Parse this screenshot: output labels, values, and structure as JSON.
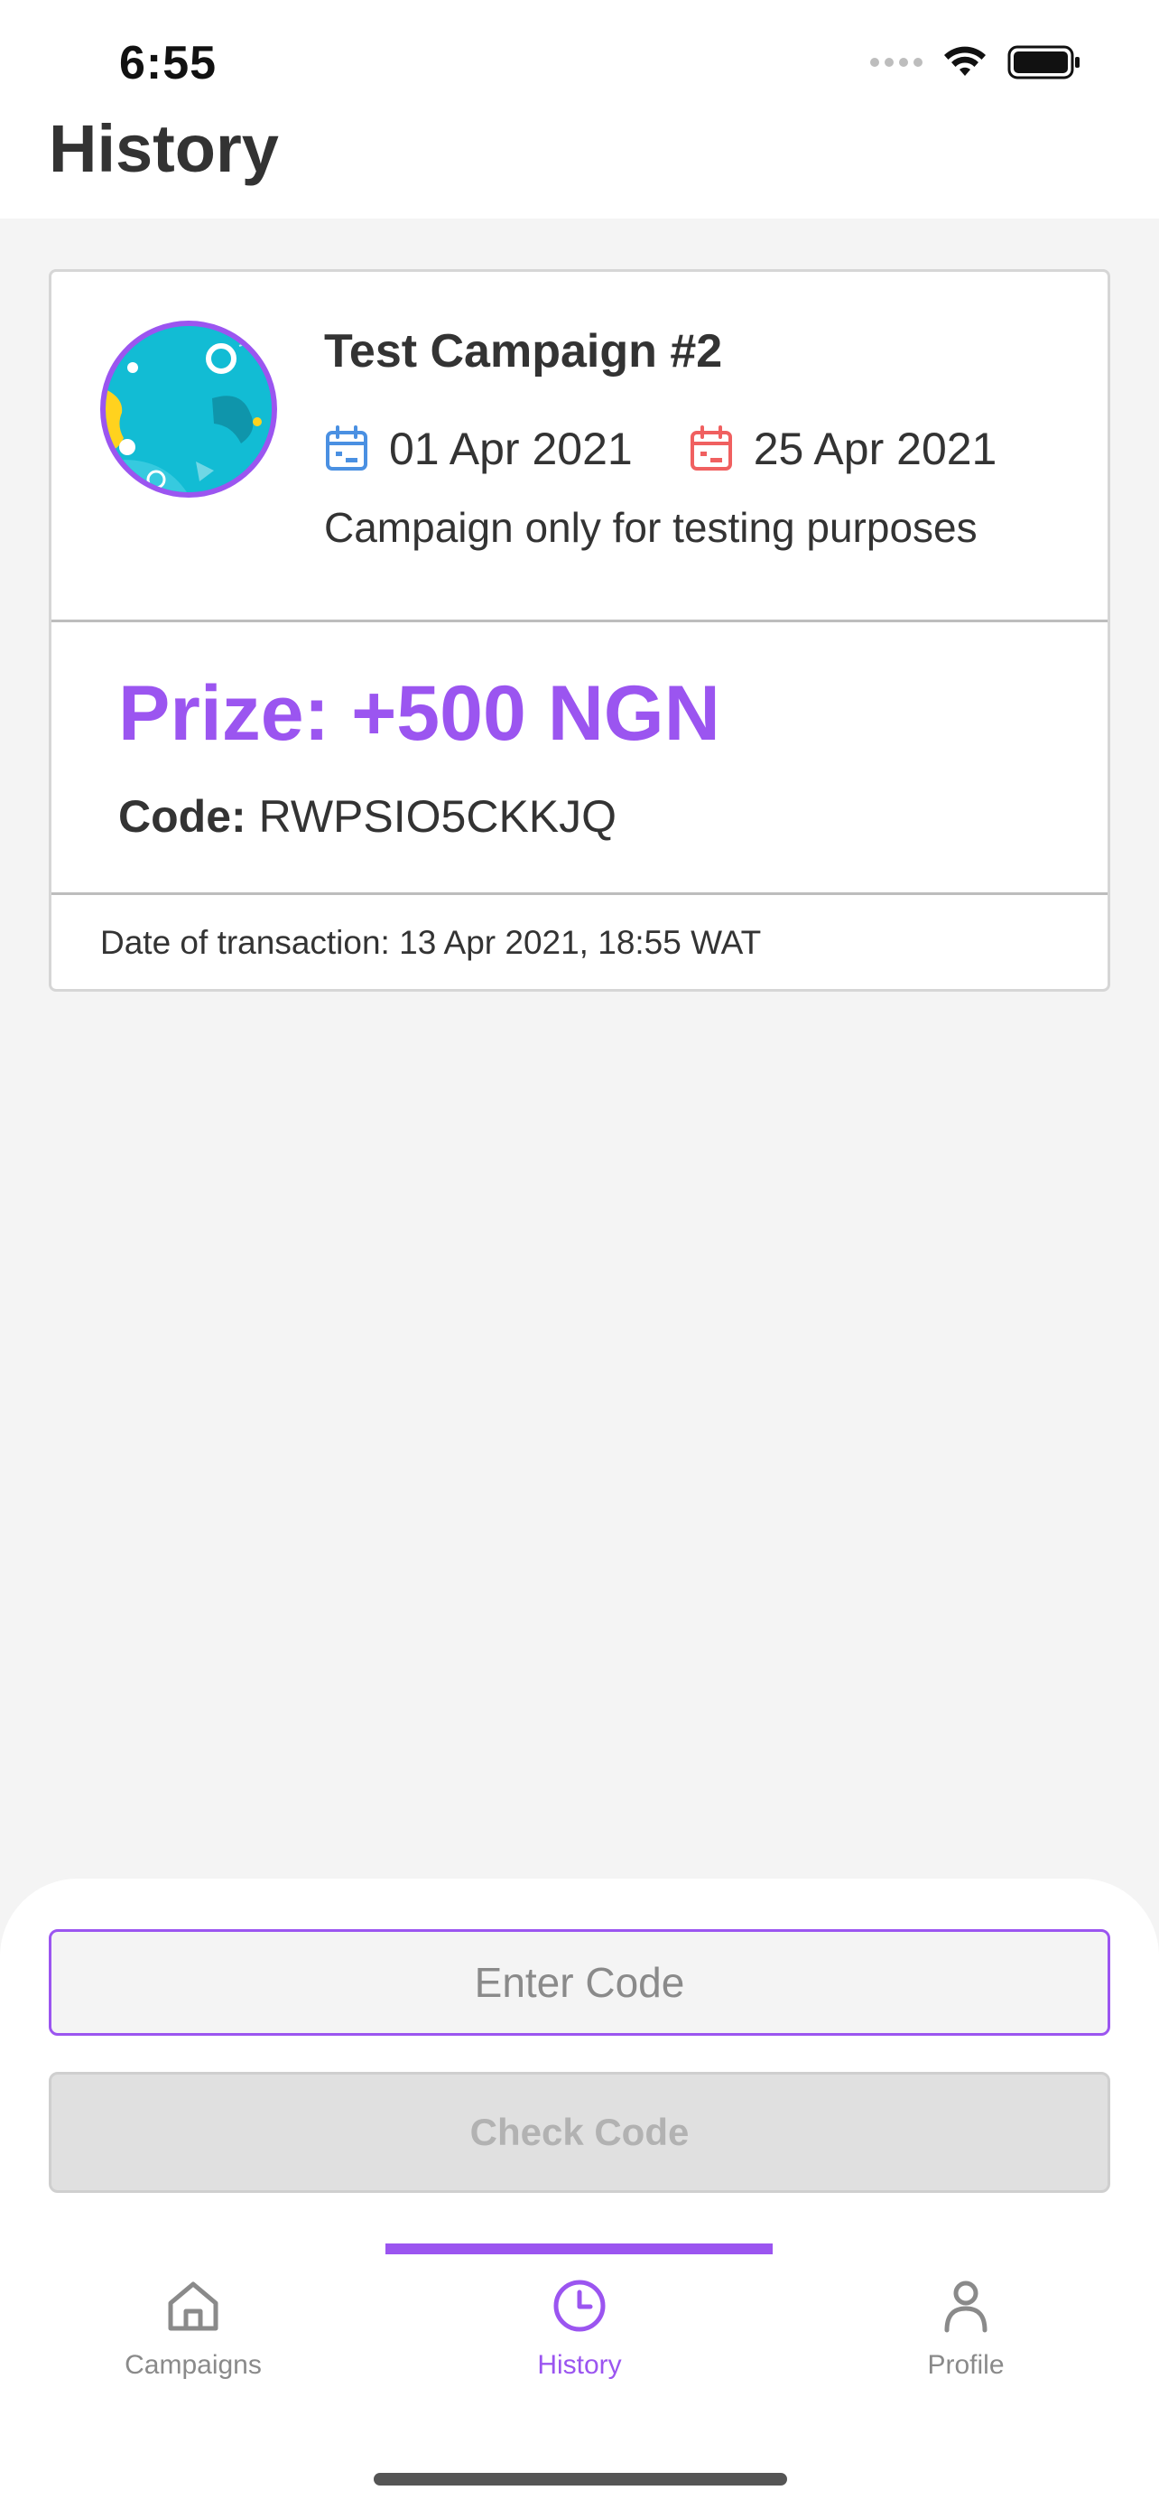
{
  "status_bar": {
    "time": "6:55"
  },
  "header": {
    "title": "History"
  },
  "history_items": [
    {
      "campaign_name": "Test Campaign #2",
      "start_date": "01 Apr 2021",
      "end_date": "25 Apr 2021",
      "description": "Campaign only for testing purposes",
      "prize": "Prize: +500 NGN",
      "code_label": "Code:",
      "code_value": "RWPSIO5CKKJQ",
      "transaction_date": "Date of transaction: 13 Apr 2021, 18:55 WAT"
    }
  ],
  "code_entry": {
    "placeholder": "Enter Code",
    "value": "",
    "button_label": "Check Code"
  },
  "tabs": [
    {
      "label": "Campaigns",
      "icon": "home-icon",
      "active": false
    },
    {
      "label": "History",
      "icon": "clock-icon",
      "active": true
    },
    {
      "label": "Profile",
      "icon": "person-icon",
      "active": false
    }
  ],
  "colors": {
    "accent": "#9b55f0",
    "start_date_icon": "#4a90e2",
    "end_date_icon": "#f06060",
    "inactive_tab": "#8a8a8a",
    "avatar_background": "#12bcd4"
  }
}
